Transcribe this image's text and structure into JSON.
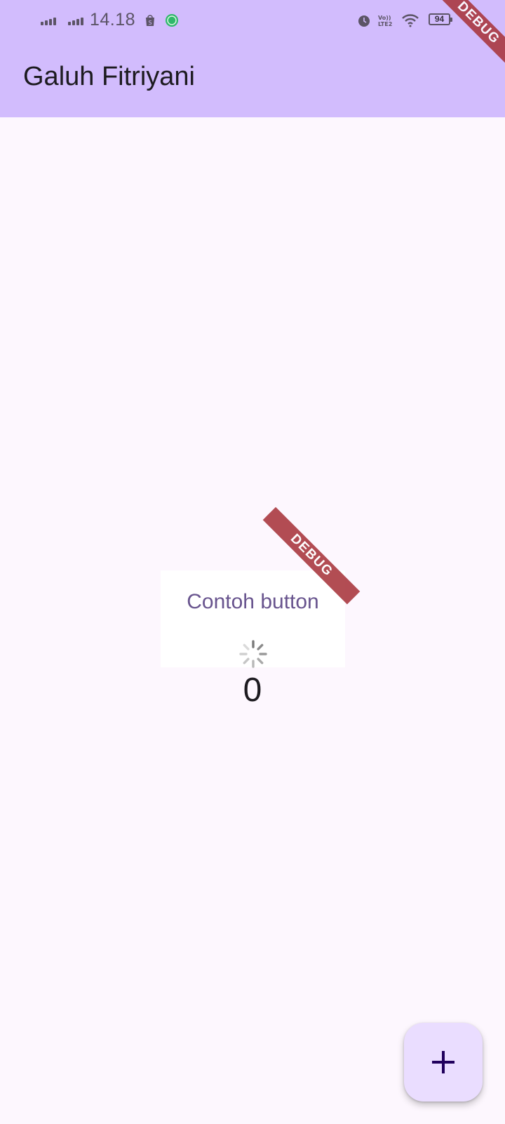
{
  "status_bar": {
    "time": "14.18",
    "battery": "94",
    "icons": [
      "signal-icon",
      "signal-icon",
      "shop-icon",
      "chat-app-icon",
      "alarm-icon",
      "volte-icon",
      "wifi-icon",
      "battery-icon"
    ]
  },
  "app_bar": {
    "title": "Galuh Fitriyani"
  },
  "debug_banner": {
    "label": "DEBUG",
    "color": "#A8353C"
  },
  "card": {
    "button_label": "Contoh button"
  },
  "counter": {
    "value": "0"
  },
  "fab": {
    "icon": "add-icon"
  },
  "colors": {
    "app_bar": "#D2BCFD",
    "background": "#FDF7FE",
    "fab": "#EADDFF",
    "button_text": "#68548E"
  }
}
